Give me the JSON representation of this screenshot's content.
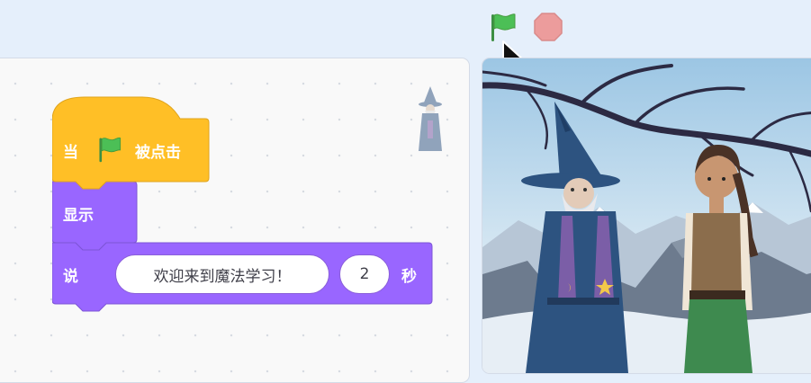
{
  "toolbar": {
    "green_flag_icon": "green-flag-icon",
    "stop_icon": "stop-sign-icon"
  },
  "code_area": {
    "hat_block": {
      "prefix": "当",
      "icon": "green-flag-icon",
      "suffix": "被点击"
    },
    "show_block": {
      "label": "显示"
    },
    "say_block": {
      "label": "说",
      "message": "欢迎来到魔法学习！",
      "seconds": "2",
      "unit": "秒"
    }
  },
  "stage": {
    "characters": [
      "wizard",
      "young-adventurer"
    ],
    "backdrop": "snowy-mountains-with-branches"
  },
  "colors": {
    "event_block": "#ffbf26",
    "looks_block": "#9966ff",
    "green_flag": "#4cbf56",
    "stop_sign": "#ec9c9c",
    "background": "#e5effb"
  }
}
